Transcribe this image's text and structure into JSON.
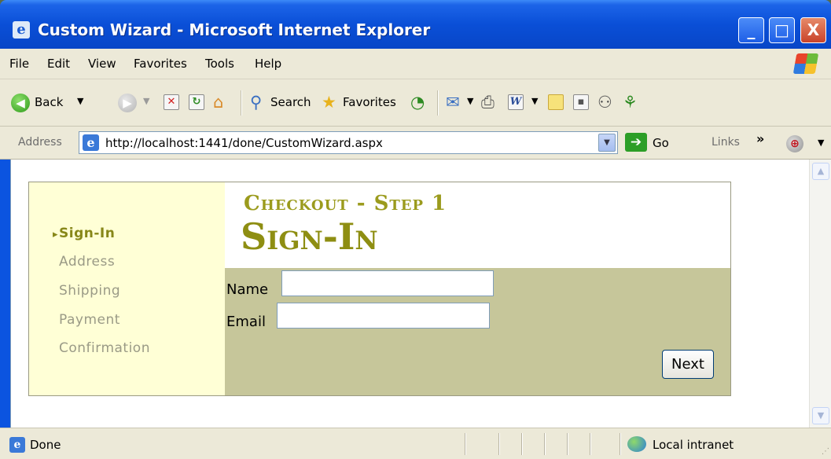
{
  "window": {
    "title": "Custom Wizard - Microsoft Internet Explorer",
    "minimize": "_",
    "maximize": "□",
    "close": "X"
  },
  "menu": {
    "items": [
      "File",
      "Edit",
      "View",
      "Favorites",
      "Tools",
      "Help"
    ]
  },
  "toolbar": {
    "back_label": "Back",
    "search_label": "Search",
    "favorites_label": "Favorites"
  },
  "address": {
    "label": "Address",
    "url": "http://localhost:1441/done/CustomWizard.aspx",
    "go_label": "Go",
    "links_label": "Links",
    "links_chevron": "»"
  },
  "wizard": {
    "steps": [
      {
        "label": "Sign-In",
        "active": true
      },
      {
        "label": "Address",
        "active": false
      },
      {
        "label": "Shipping",
        "active": false
      },
      {
        "label": "Payment",
        "active": false
      },
      {
        "label": "Confirmation",
        "active": false
      }
    ],
    "step_header": "Checkout - Step 1",
    "title": "Sign-In",
    "fields": {
      "name_label": "Name",
      "name_value": "",
      "email_label": "Email",
      "email_value": ""
    },
    "next_label": "Next"
  },
  "status": {
    "text": "Done",
    "zone": "Local intranet"
  },
  "colors": {
    "accent_olive": "#8e8e12",
    "sidebar_bg": "#ffffd6",
    "form_bg": "#c6c69a",
    "xp_blue": "#0a4fd7"
  }
}
